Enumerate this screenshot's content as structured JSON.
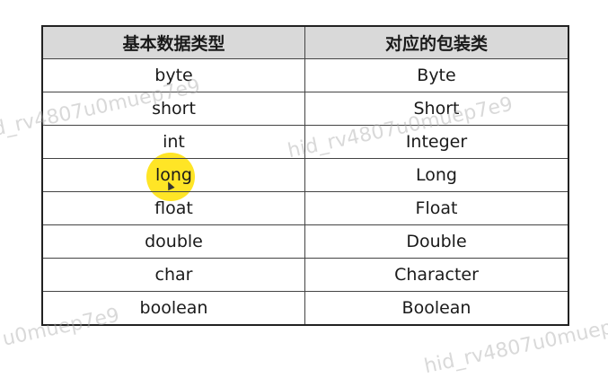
{
  "table": {
    "headers": [
      "基本数据类型",
      "对应的包装类"
    ],
    "rows": [
      [
        "byte",
        "Byte"
      ],
      [
        "short",
        "Short"
      ],
      [
        "int",
        "Integer"
      ],
      [
        "long",
        "Long"
      ],
      [
        "float",
        "Float"
      ],
      [
        "double",
        "Double"
      ],
      [
        "char",
        "Character"
      ],
      [
        "boolean",
        "Boolean"
      ]
    ]
  },
  "watermark": "hid_rv4807u0muep7e9",
  "colors": {
    "header_bg": "#d9d9d9",
    "cursor_highlight": "#ffe100"
  }
}
